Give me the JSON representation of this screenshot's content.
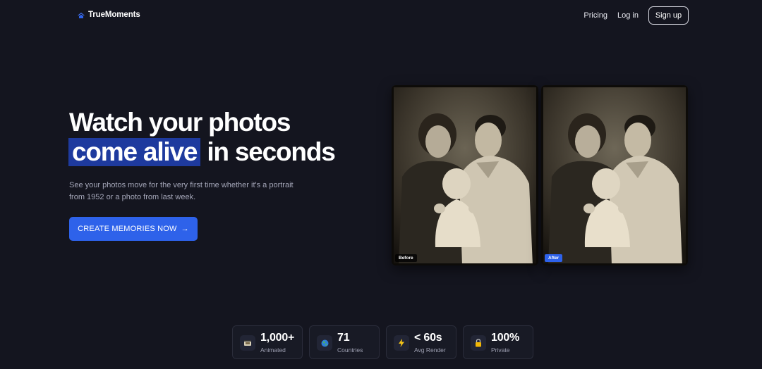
{
  "brand": {
    "name": "TrueMoments",
    "icon": "home-logo-icon"
  },
  "nav": {
    "pricing": "Pricing",
    "login": "Log in",
    "signup": "Sign up"
  },
  "hero": {
    "title_line1": "Watch your photos",
    "title_highlight": "come alive",
    "title_rest": "in seconds",
    "subtitle": "See your photos move for the very first time whether it's a portrait from 1952 or a photo from last week.",
    "cta": "CREATE MEMORIES NOW",
    "cta_icon": "arrow-right-icon"
  },
  "photos": {
    "before_label": "Before",
    "after_label": "After"
  },
  "stats": [
    {
      "value": "1,000+",
      "label": "Animated",
      "icon": "film-icon"
    },
    {
      "value": "71",
      "label": "Countries",
      "icon": "globe-icon"
    },
    {
      "value": "< 60s",
      "label": "Avg Render",
      "icon": "lightning-icon"
    },
    {
      "value": "100%",
      "label": "Private",
      "icon": "lock-icon"
    }
  ],
  "colors": {
    "background": "#14151f",
    "accent": "#2e62ea",
    "highlight": "#1e3a9e"
  }
}
